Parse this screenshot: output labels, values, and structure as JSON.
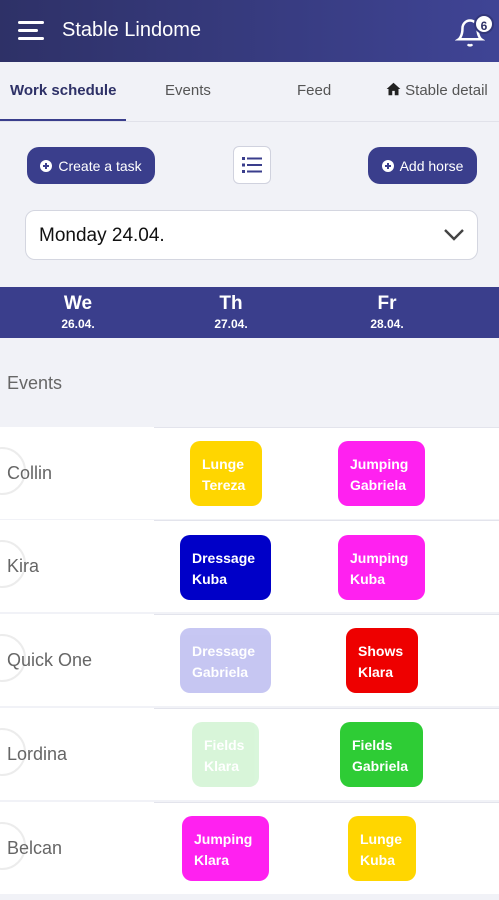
{
  "app": {
    "title": "Stable Lindome",
    "notification_count": "6"
  },
  "tabs": [
    "Work schedule",
    "Events",
    "Feed",
    "Stable detail"
  ],
  "actions": {
    "create_task": "Create a task",
    "add_horse": "Add horse"
  },
  "date_select": {
    "value": "Monday 24.04."
  },
  "days": [
    {
      "name": "We",
      "date": "26.04."
    },
    {
      "name": "Th",
      "date": "27.04."
    },
    {
      "name": "Fr",
      "date": "28.04."
    }
  ],
  "events_label": "Events",
  "horses": [
    {
      "name": "Collin",
      "tasks": [
        {
          "day": 1,
          "task": "Lunge",
          "person": "Tereza",
          "color": "#ffd600",
          "faded": false
        },
        {
          "day": 2,
          "task": "Jumping",
          "person": "Gabriela",
          "color": "#ff21f0",
          "faded": false
        }
      ]
    },
    {
      "name": "Kira",
      "tasks": [
        {
          "day": 1,
          "task": "Dressage",
          "person": "Kuba",
          "color": "#0000c8",
          "faded": false
        },
        {
          "day": 2,
          "task": "Jumping",
          "person": "Kuba",
          "color": "#ff21f0",
          "faded": false
        }
      ]
    },
    {
      "name": "Quick One",
      "tasks": [
        {
          "day": 1,
          "task": "Dressage",
          "person": "Gabriela",
          "color": "#0000c8",
          "faded": true
        },
        {
          "day": 2,
          "task": "Shows",
          "person": "Klara",
          "color": "#ee0000",
          "faded": false
        }
      ]
    },
    {
      "name": "Lordina",
      "tasks": [
        {
          "day": 1,
          "task": "Fields",
          "person": "Klara",
          "color": "#2ecc35",
          "faded": true
        },
        {
          "day": 2,
          "task": "Fields",
          "person": "Gabriela",
          "color": "#2ecc35",
          "faded": false
        }
      ]
    },
    {
      "name": "Belcan",
      "tasks": [
        {
          "day": 1,
          "task": "Jumping",
          "person": "Klara",
          "color": "#ff21f0",
          "faded": false
        },
        {
          "day": 2,
          "task": "Lunge",
          "person": "Kuba",
          "color": "#ffd600",
          "faded": false
        }
      ]
    }
  ],
  "colors": {
    "primary": "#3a3e8c",
    "appbar_dark": "#2e3167"
  },
  "icons": [
    "menu-icon",
    "bell-icon",
    "home-icon",
    "plus-circle-icon",
    "list-icon",
    "chevron-down-icon"
  ]
}
